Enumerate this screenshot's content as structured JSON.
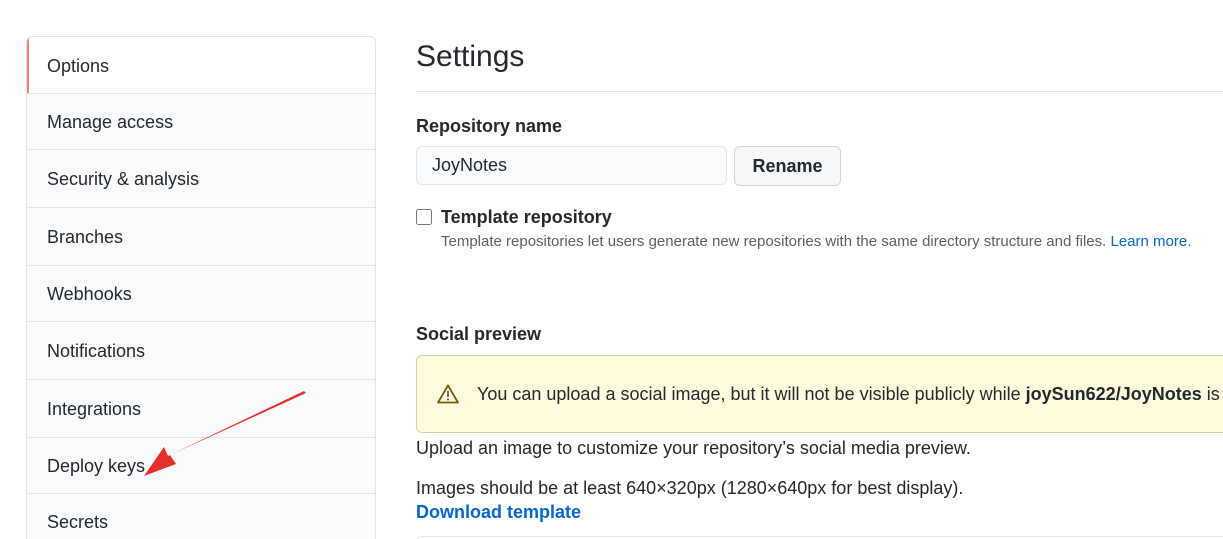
{
  "sidebar": {
    "items": [
      {
        "label": "Options"
      },
      {
        "label": "Manage access"
      },
      {
        "label": "Security & analysis"
      },
      {
        "label": "Branches"
      },
      {
        "label": "Webhooks"
      },
      {
        "label": "Notifications"
      },
      {
        "label": "Integrations"
      },
      {
        "label": "Deploy keys"
      },
      {
        "label": "Secrets"
      }
    ],
    "selected": "Options"
  },
  "main": {
    "title": "Settings",
    "repo_name": {
      "label": "Repository name",
      "value": "JoyNotes",
      "rename_label": "Rename"
    },
    "template": {
      "label": "Template repository",
      "checked": false,
      "description": "Template repositories let users generate new repositories with the same directory structure and files.",
      "learn_more": "Learn more"
    },
    "social": {
      "label": "Social preview",
      "warning_prefix": "You can upload a social image, but it will not be visible publicly while ",
      "warning_repo": "joySun622/JoyNotes",
      "warning_suffix": " is priv",
      "upload_text": "Upload an image to customize your repository’s social media preview.",
      "size_text": "Images should be at least 640×320px (1280×640px for best display).",
      "download_link": "Download template"
    }
  },
  "colors": {
    "accent_link": "#0366d6",
    "selected_marker": "#f9826c",
    "warning_bg": "#fffbdd",
    "annotation_arrow": "#e8302a"
  },
  "icons": {
    "warning": "alert-triangle-icon",
    "annotation": "red-arrow-icon"
  }
}
